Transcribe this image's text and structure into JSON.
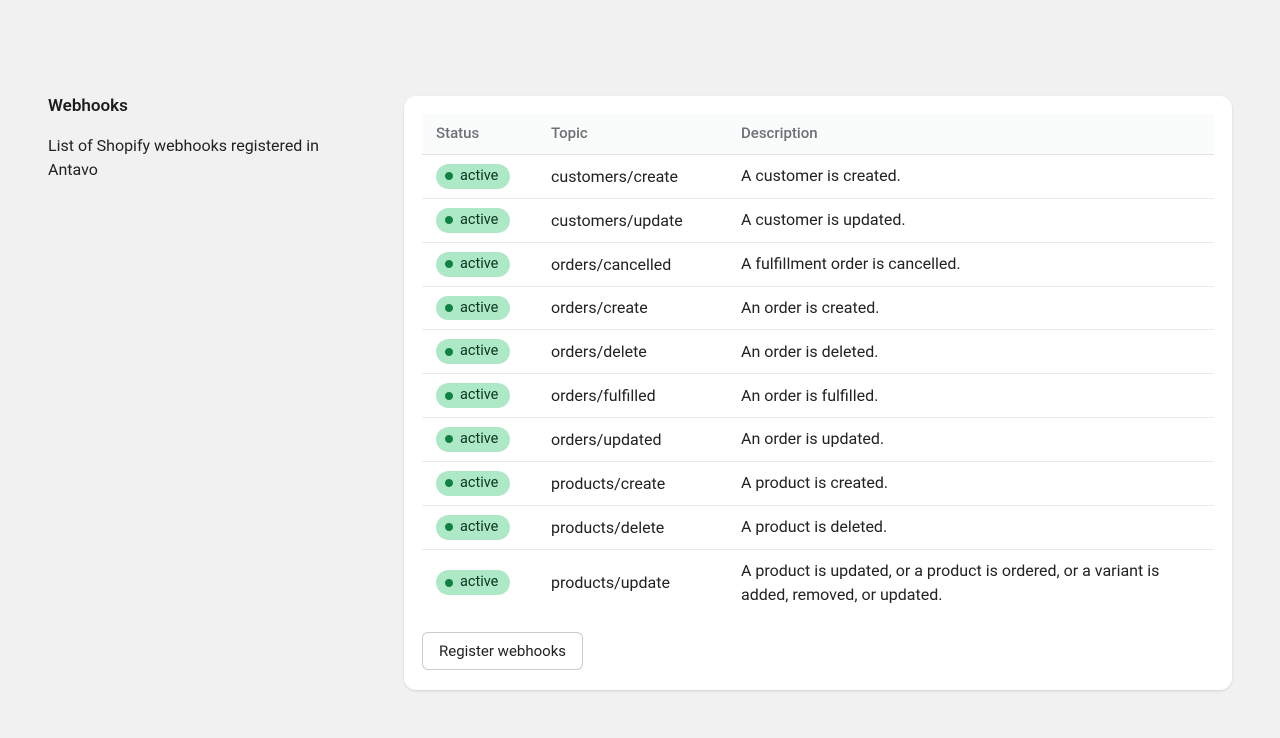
{
  "sidebar": {
    "title": "Webhooks",
    "description": "List of Shopify webhooks registered in Antavo"
  },
  "table": {
    "headers": {
      "status": "Status",
      "topic": "Topic",
      "description": "Description"
    },
    "rows": [
      {
        "status": "active",
        "topic": "customers/create",
        "description": "A customer is created."
      },
      {
        "status": "active",
        "topic": "customers/update",
        "description": "A customer is updated."
      },
      {
        "status": "active",
        "topic": "orders/cancelled",
        "description": "A fulfillment order is cancelled."
      },
      {
        "status": "active",
        "topic": "orders/create",
        "description": "An order is created."
      },
      {
        "status": "active",
        "topic": "orders/delete",
        "description": "An order is deleted."
      },
      {
        "status": "active",
        "topic": "orders/fulfilled",
        "description": "An order is fulfilled."
      },
      {
        "status": "active",
        "topic": "orders/updated",
        "description": "An order is updated."
      },
      {
        "status": "active",
        "topic": "products/create",
        "description": "A product is created."
      },
      {
        "status": "active",
        "topic": "products/delete",
        "description": "A product is deleted."
      },
      {
        "status": "active",
        "topic": "products/update",
        "description": "A product is updated, or a product is ordered, or a variant is added, removed, or updated."
      }
    ]
  },
  "actions": {
    "register_label": "Register webhooks"
  },
  "colors": {
    "badge_bg": "#aee9c7",
    "badge_dot": "#108043"
  }
}
